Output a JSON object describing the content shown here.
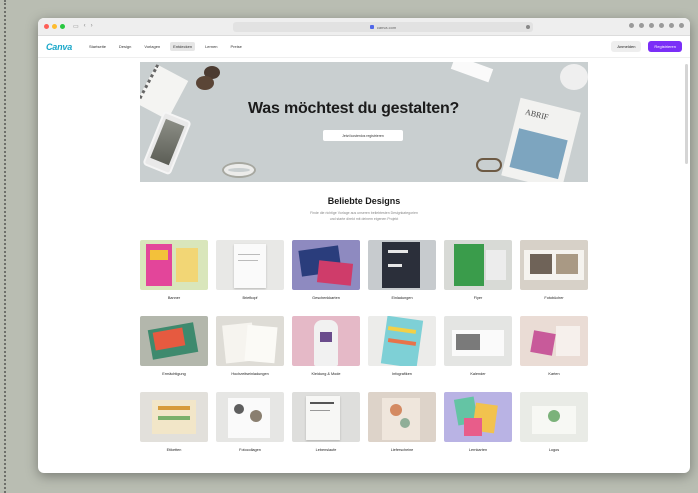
{
  "browser": {
    "address": "canva.com"
  },
  "header": {
    "logo": "Canva",
    "nav": [
      "Startseite",
      "Design",
      "Vorlagen",
      "Entdecken",
      "Lernen",
      "Preise"
    ],
    "active_nav_index": 3,
    "login_label": "Anmelden",
    "signup_label": "Registrieren",
    "accent_color": "#7b2ff7"
  },
  "hero": {
    "title": "Was möchtest du gestalten?",
    "button_label": "Jetzt kostenlos registrieren"
  },
  "popular": {
    "title": "Beliebte Designs",
    "subtitle_line1": "Finde die richtige Vorlage aus unseren beliebtesten Designkategorien",
    "subtitle_line2": "und starte direkt mit deinem eigenen Projekt"
  },
  "designs": [
    {
      "label": "Banner"
    },
    {
      "label": "Briefkopf"
    },
    {
      "label": "Geschenkkarten"
    },
    {
      "label": "Einladungen"
    },
    {
      "label": "Flyer"
    },
    {
      "label": "Fotobücher"
    },
    {
      "label": "Ermächtigung"
    },
    {
      "label": "Hochzeitseinladungen"
    },
    {
      "label": "Kleidung & Mode"
    },
    {
      "label": "Infografiken"
    },
    {
      "label": "Kalender"
    },
    {
      "label": "Karten"
    },
    {
      "label": "Etiketten"
    },
    {
      "label": "Fotocollagen"
    },
    {
      "label": "Lebenslaufe"
    },
    {
      "label": "Lieferscheine"
    },
    {
      "label": "Lernkarten"
    },
    {
      "label": "Logos"
    }
  ]
}
